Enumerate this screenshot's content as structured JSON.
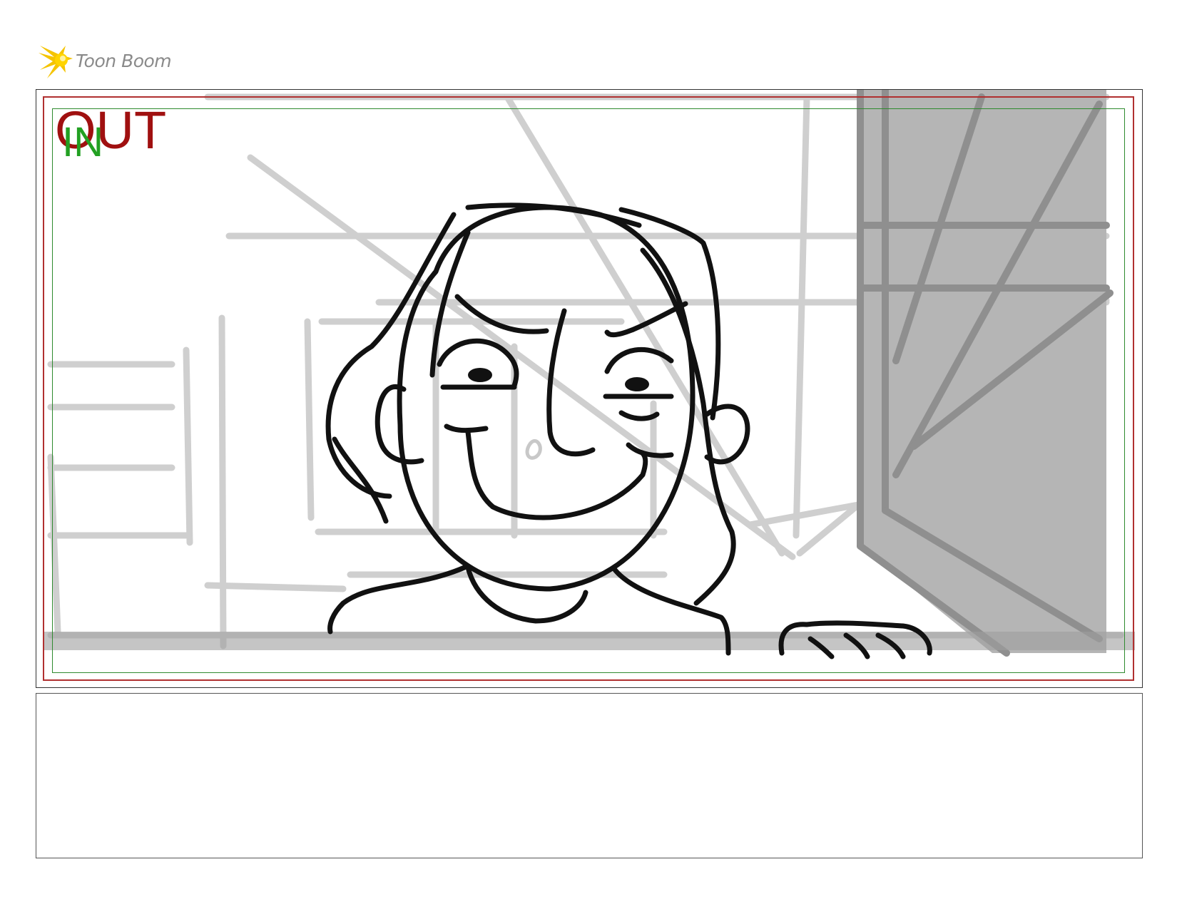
{
  "logo": {
    "brand_text": "Toon Boom",
    "icon": "starburst-logo-icon",
    "accent_color": "#f5c400"
  },
  "panel": {
    "out_label": "OUT",
    "in_label": "IN",
    "out_color": "#a01010",
    "in_color": "#22a022"
  },
  "notes": {
    "text": ""
  }
}
